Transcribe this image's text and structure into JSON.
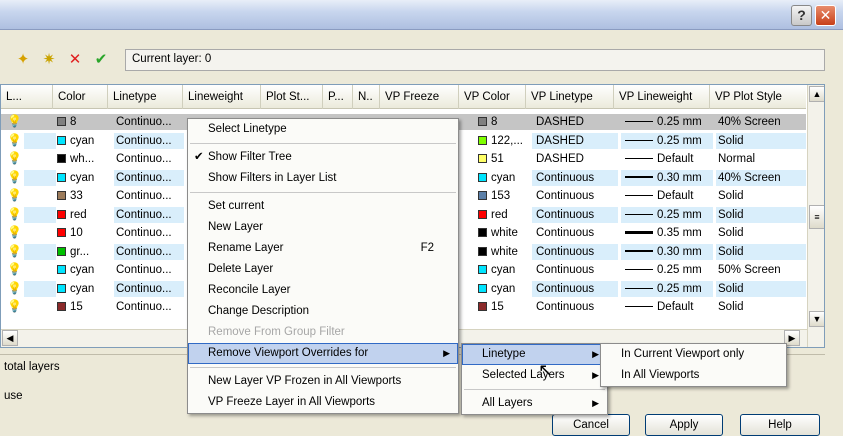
{
  "titlebar": {
    "help_label": "?",
    "close_label": "✕"
  },
  "toolbar": {
    "current_layer_text": "Current layer: 0"
  },
  "columns": [
    "L...",
    "Color",
    "Linetype",
    "Lineweight",
    "Plot St...",
    "P...",
    "N..",
    "VP Freeze",
    "VP Color",
    "VP Linetype",
    "VP Lineweight",
    "VP Plot Style"
  ],
  "rows": [
    {
      "color_name": "8",
      "swatch": "#808080",
      "linetype": "Continuo...",
      "vp_color": "8",
      "vp_swatch": "#808080",
      "vp_linetype": "DASHED",
      "vp_lineweight": "0.25 mm",
      "vp_plot_style": "40% Screen"
    },
    {
      "color_name": "cyan",
      "swatch": "#00e5ff",
      "linetype": "Continuo...",
      "vp_color": "122,...",
      "vp_swatch": "#7fff00",
      "vp_linetype": "DASHED",
      "vp_lineweight": "0.25 mm",
      "vp_plot_style": "Solid"
    },
    {
      "color_name": "wh...",
      "swatch": "#000000",
      "linetype": "Continuo...",
      "vp_color": "51",
      "vp_swatch": "#ffff66",
      "vp_linetype": "DASHED",
      "vp_lineweight": "Default",
      "vp_plot_style": "Normal"
    },
    {
      "color_name": "cyan",
      "swatch": "#00e5ff",
      "linetype": "Continuo...",
      "vp_color": "cyan",
      "vp_swatch": "#00e5ff",
      "vp_linetype": "Continuous",
      "vp_lineweight": "0.30 mm",
      "vp_plot_style": "40% Screen"
    },
    {
      "color_name": "33",
      "swatch": "#9c7b5a",
      "linetype": "Continuo...",
      "vp_color": "153",
      "vp_swatch": "#5b7fa8",
      "vp_linetype": "Continuous",
      "vp_lineweight": "Default",
      "vp_plot_style": "Solid"
    },
    {
      "color_name": "red",
      "swatch": "#ff0000",
      "linetype": "Continuo...",
      "vp_color": "red",
      "vp_swatch": "#ff0000",
      "vp_linetype": "Continuous",
      "vp_lineweight": "0.25 mm",
      "vp_plot_style": "Solid"
    },
    {
      "color_name": "10",
      "swatch": "#ff0000",
      "linetype": "Continuo...",
      "vp_color": "white",
      "vp_swatch": "#000000",
      "vp_linetype": "Continuous",
      "vp_lineweight": "0.35 mm",
      "vp_plot_style": "Solid"
    },
    {
      "color_name": "gr...",
      "swatch": "#00c000",
      "linetype": "Continuo...",
      "vp_color": "white",
      "vp_swatch": "#000000",
      "vp_linetype": "Continuous",
      "vp_lineweight": "0.30 mm",
      "vp_plot_style": "Solid"
    },
    {
      "color_name": "cyan",
      "swatch": "#00e5ff",
      "linetype": "Continuo...",
      "vp_color": "cyan",
      "vp_swatch": "#00e5ff",
      "vp_linetype": "Continuous",
      "vp_lineweight": "0.25 mm",
      "vp_plot_style": "50% Screen"
    },
    {
      "color_name": "cyan",
      "swatch": "#00e5ff",
      "linetype": "Continuo...",
      "vp_color": "cyan",
      "vp_swatch": "#00e5ff",
      "vp_linetype": "Continuous",
      "vp_lineweight": "0.25 mm",
      "vp_plot_style": "Solid"
    },
    {
      "color_name": "15",
      "swatch": "#8b2a2a",
      "linetype": "Continuo...",
      "vp_color": "15",
      "vp_swatch": "#8b2a2a",
      "vp_linetype": "Continuous",
      "vp_lineweight": "Default",
      "vp_plot_style": "Solid"
    }
  ],
  "status": {
    "total_layers": "total layers",
    "use": "use"
  },
  "buttons": {
    "cancel": "Cancel",
    "apply": "Apply",
    "help": "Help"
  },
  "context_menu": [
    {
      "label": "Select Linetype"
    },
    {
      "sep": true
    },
    {
      "label": "Show Filter Tree",
      "checked": true
    },
    {
      "label": "Show Filters in Layer List"
    },
    {
      "sep": true
    },
    {
      "label": "Set current"
    },
    {
      "label": "New Layer"
    },
    {
      "label": "Rename Layer",
      "shortcut": "F2"
    },
    {
      "label": "Delete Layer"
    },
    {
      "label": "Reconcile Layer"
    },
    {
      "label": "Change Description"
    },
    {
      "label": "Remove From Group Filter",
      "disabled": true
    },
    {
      "label": "Remove Viewport Overrides for",
      "submenu": true,
      "active": true
    },
    {
      "sep": true
    },
    {
      "label": "New Layer VP Frozen in All Viewports"
    },
    {
      "label": "VP Freeze Layer in All Viewports"
    }
  ],
  "submenu1": [
    {
      "label": "Linetype",
      "submenu": true,
      "active": true
    },
    {
      "label": "Selected Layers",
      "submenu": true
    },
    {
      "sep": true
    },
    {
      "label": "All Layers",
      "submenu": true
    }
  ],
  "submenu2": [
    {
      "label": "In Current Viewport only"
    },
    {
      "label": "In All Viewports"
    }
  ],
  "colors": {
    "row_highlight": "#d9eefb",
    "selected_row": "#c5c5c5",
    "menu_active": "#c1d2ee"
  }
}
